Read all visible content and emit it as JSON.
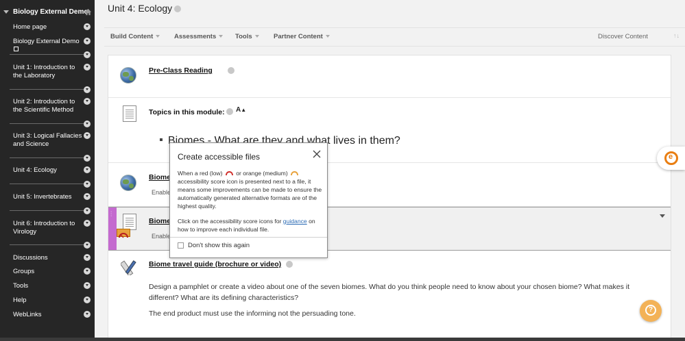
{
  "sidebar": {
    "course_title": "Biology External Demo",
    "items": [
      {
        "label": "Home page"
      },
      {
        "label": "Biology External Demo"
      },
      {
        "label": "Unit 1: Introduction to the Laboratory"
      },
      {
        "label": "Unit 2: Introduction to the Scientific Method"
      },
      {
        "label": "Unit 3: Logical Fallacies and Science"
      },
      {
        "label": "Unit 4: Ecology"
      },
      {
        "label": "Unit 5: Invertebrates"
      },
      {
        "label": "Unit 6: Introduction to Virology"
      },
      {
        "label": "Discussions"
      },
      {
        "label": "Groups"
      },
      {
        "label": "Tools"
      },
      {
        "label": "Help"
      },
      {
        "label": "WebLinks"
      }
    ]
  },
  "page": {
    "title": "Unit 4: Ecology"
  },
  "toolbar": {
    "build_content": "Build Content",
    "assessments": "Assessments",
    "tools": "Tools",
    "partner_content": "Partner Content",
    "discover_content": "Discover Content"
  },
  "content": {
    "pre_class_reading": "Pre-Class Reading",
    "topics_title": "Topics in this module:",
    "topics_bullet": "Biomes - What are they and what lives in them?",
    "biome_item_1_title": "Biome",
    "biome_item_1_desc": "Enable",
    "biome_item_2_title": "Biome",
    "biome_item_2_desc": "Enable",
    "travel_guide_title": "Biome travel guide (brochure or video)",
    "travel_guide_desc": "Design a pamphlet or create a video about one of the seven biomes. What do you think people need to know about your chosen biome?  What makes it different? What are its defining characteristics?",
    "travel_guide_end": "The end product must use the informing not the persuading tone."
  },
  "popup": {
    "title": "Create accessible files",
    "p1_a": "When a red (low)",
    "p1_b": "or orange (medium)",
    "p1_c": "accessibility score icon is presented next to a file, it means some improvements can be made to ensure the automatically generated alternative formats are of the highest quality.",
    "p2_a": "Click on the accessibility score icons for",
    "p2_link": "guidance",
    "p2_b": "on how to improve each individual file.",
    "checkbox_label": "Don't show this again"
  },
  "colors": {
    "sidebar_bg": "#262626",
    "selected_stripe": "#c46acf",
    "low_score": "#d0312d",
    "medium_score": "#e8a23c",
    "link": "#2d6cb5",
    "help_button": "#f3b257",
    "ally_orange": "#e97e12"
  },
  "icons": {
    "home": "home-icon",
    "globe": "globe-icon",
    "document": "document-icon",
    "pencil": "pencil-ruler-icon",
    "close": "close-icon",
    "help": "question-icon",
    "ally": "ally-icon"
  }
}
